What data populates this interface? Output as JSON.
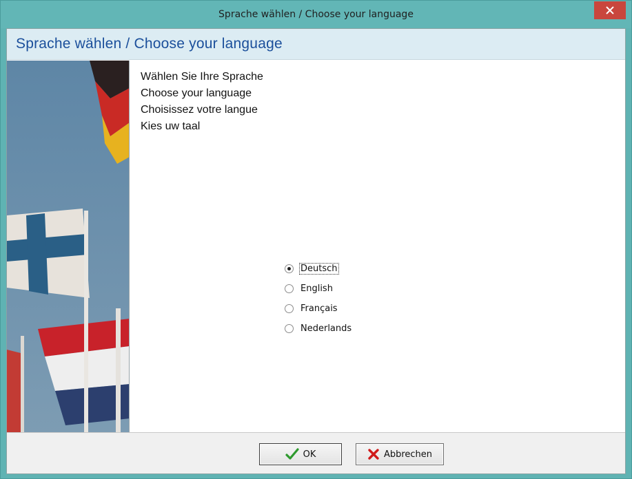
{
  "window": {
    "title": "Sprache wählen / Choose your language",
    "close_label": "×"
  },
  "header": {
    "title": "Sprache wählen / Choose your language"
  },
  "intro": {
    "lines": [
      "Wählen Sie Ihre Sprache",
      "Choose your language",
      "Choisissez votre langue",
      "Kies uw taal"
    ]
  },
  "languages": {
    "options": [
      {
        "label": "Deutsch",
        "selected": true
      },
      {
        "label": "English",
        "selected": false
      },
      {
        "label": "Français",
        "selected": false
      },
      {
        "label": "Nederlands",
        "selected": false
      }
    ]
  },
  "buttons": {
    "ok_label": "OK",
    "cancel_label": "Abbrechen",
    "ok_icon": "check-icon",
    "cancel_icon": "x-mark-icon"
  },
  "colors": {
    "accent_title": "#1b4f9b",
    "header_band": "#dcecf3",
    "window_frame": "#62b6b6",
    "close_button": "#c9463d",
    "check_green": "#2e9a2e",
    "cancel_red": "#d01a1a"
  }
}
